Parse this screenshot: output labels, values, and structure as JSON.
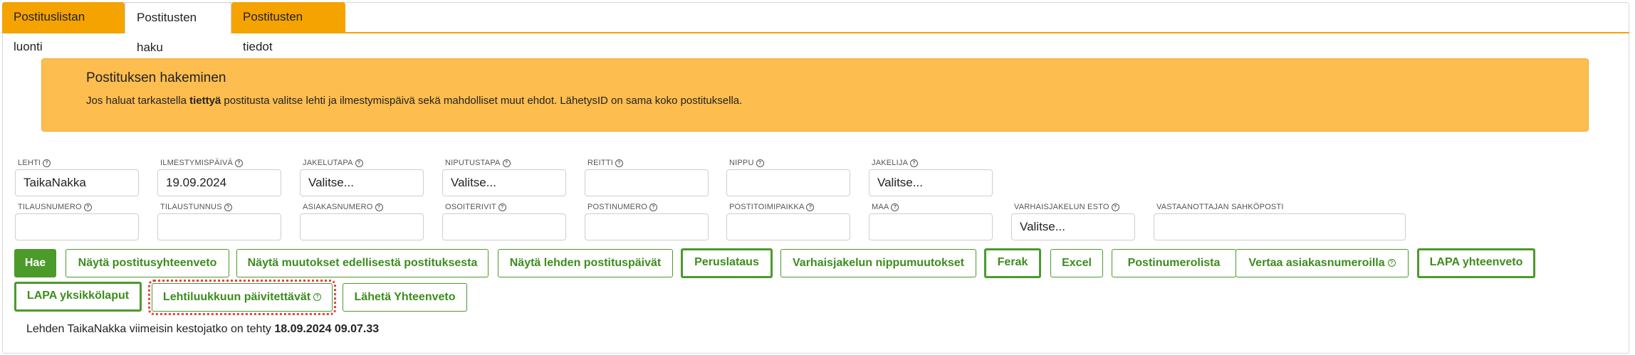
{
  "tabs": [
    {
      "label": "Postituslistan luonti"
    },
    {
      "label": "Postitusten haku"
    },
    {
      "label": "Postitusten tiedot"
    }
  ],
  "banner": {
    "title": "Postituksen hakeminen",
    "text_before": "Jos haluat tarkastella ",
    "text_bold": "tiettyä",
    "text_after": " postitusta valitse lehti ja ilmestymispäivä sekä mahdolliset muut ehdot. LähetysID on sama koko postituksella."
  },
  "filters_row1": [
    {
      "label": "LEHTI",
      "value": "TaikaNakka"
    },
    {
      "label": "ILMESTYMISPÄIVÄ",
      "value": "19.09.2024"
    },
    {
      "label": "JAKELUTAPA",
      "value": "Valitse..."
    },
    {
      "label": "NIPUTUSTAPA",
      "value": "Valitse..."
    },
    {
      "label": "REITTI",
      "value": ""
    },
    {
      "label": "NIPPU",
      "value": ""
    },
    {
      "label": "JAKELIJA",
      "value": "Valitse..."
    }
  ],
  "filters_row2": [
    {
      "label": "TILAUSNUMERO",
      "value": ""
    },
    {
      "label": "TILAUSTUNNUS",
      "value": ""
    },
    {
      "label": "ASIAKASNUMERO",
      "value": ""
    },
    {
      "label": "OSOITERIVIT",
      "value": ""
    },
    {
      "label": "POSTINUMERO",
      "value": ""
    },
    {
      "label": "POSTITOIMIPAIKKA",
      "value": ""
    },
    {
      "label": "MAA",
      "value": ""
    },
    {
      "label": "VARHAISJAKELUN ESTO",
      "value": "Valitse..."
    },
    {
      "label": "VASTAANOTTAJAN SAHKÖPOSTI",
      "value": ""
    }
  ],
  "help_glyph": "?",
  "buttons_row1": [
    {
      "label": "Hae"
    },
    {
      "label": "Näytä postitusyhteenveto"
    },
    {
      "label": "Näytä muutokset edellisestä postituksesta"
    },
    {
      "label": "Näytä lehden postituspäivät"
    },
    {
      "label": "Peruslataus"
    },
    {
      "label": "Varhaisjakelun nippumuutokset"
    },
    {
      "label": "Ferak"
    },
    {
      "label": "Excel"
    },
    {
      "label": "Postinumerolista"
    },
    {
      "label": "Vertaa asiakasnumeroilla"
    },
    {
      "label": "LAPA yhteenveto"
    }
  ],
  "buttons_row2": [
    {
      "label": "LAPA yksikkölaput"
    },
    {
      "label": "Lehtiluukkuun päivitettävät"
    },
    {
      "label": "Lähetä Yhteenveto"
    }
  ],
  "status": {
    "prefix": "Lehden ",
    "paper": "TaikaNakka",
    "middle": " viimeisin kestojatko on tehty ",
    "datetime": "18.09.2024 09.07.33"
  },
  "colors": {
    "tab_orange": "#f5a300",
    "banner_bg": "#fdbd4f",
    "button_green": "#4c9a2a",
    "focus_outline": "#e0443a"
  }
}
